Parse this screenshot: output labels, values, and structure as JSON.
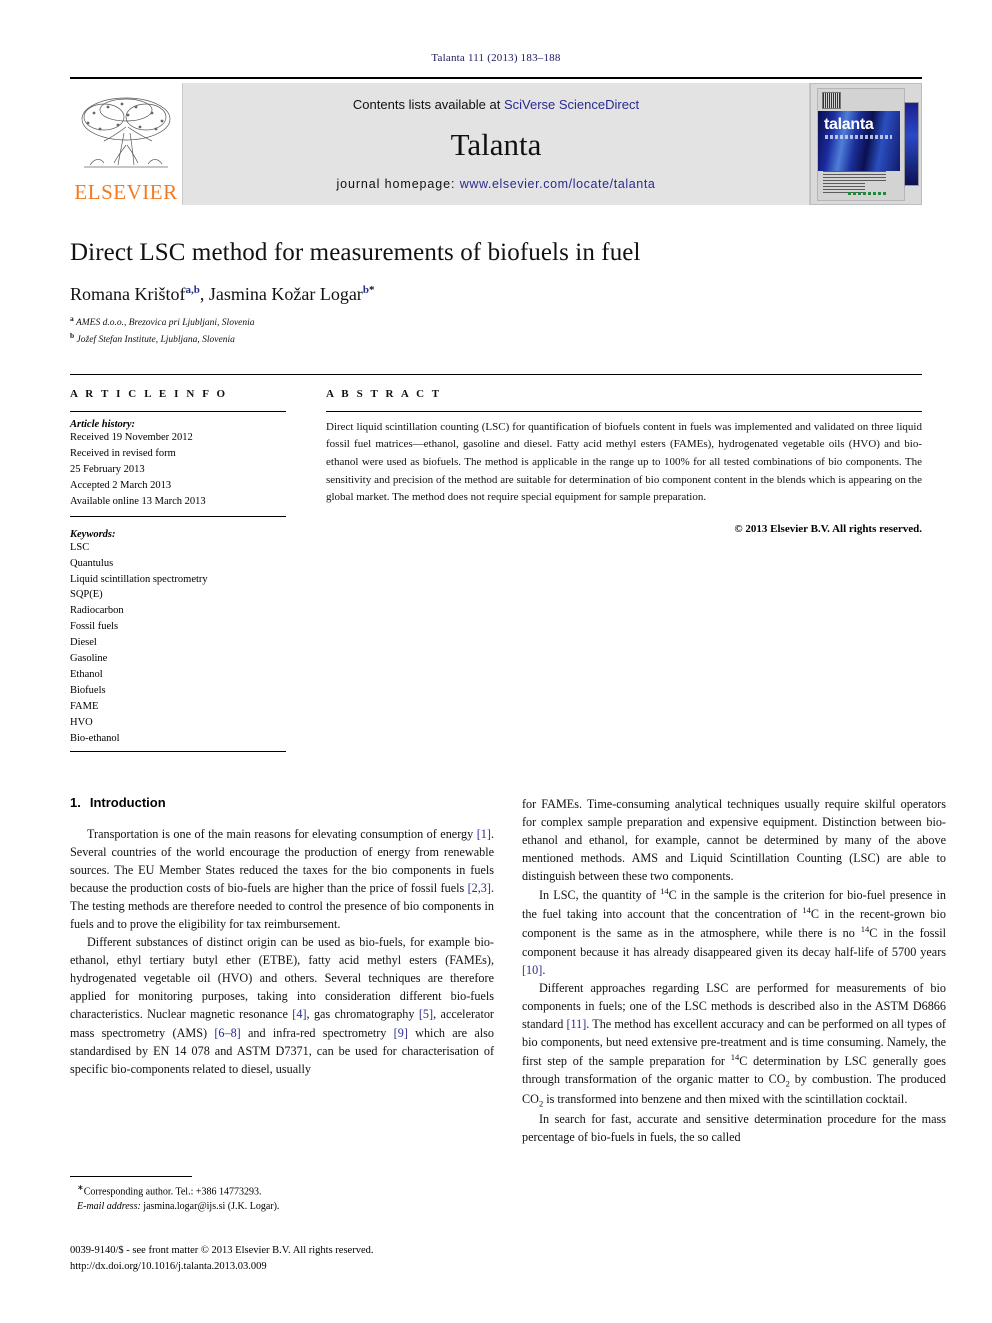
{
  "running_head": "Talanta 111 (2013) 183–188",
  "banner": {
    "publisher_logo_text": "ELSEVIER",
    "contents_prefix": "Contents lists available at ",
    "contents_link": "SciVerse ScienceDirect",
    "journal_name": "Talanta",
    "homepage_prefix": "journal homepage: ",
    "homepage_link": "www.elsevier.com/locate/talanta",
    "cover_title": "talanta"
  },
  "article": {
    "title": "Direct LSC method for measurements of biofuels in fuel",
    "authors_plain": "Romana Krištof",
    "author_1": "Romana Krištof",
    "author_1_sup": "a,b",
    "author_2": "Jasmina Kožar Logar",
    "author_2_sup": "b",
    "author_2_star": "*",
    "separator": ", ",
    "affiliation_a_sup": "a",
    "affiliation_a": "AMES d.o.o., Brezovica pri Ljubljani, Slovenia",
    "affiliation_b_sup": "b",
    "affiliation_b": "Jožef Stefan Institute, Ljubljana, Slovenia"
  },
  "info": {
    "heading": "A R T I C L E  I N F O",
    "history_label": "Article history:",
    "history": [
      "Received 19 November 2012",
      "Received in revised form",
      "25 February 2013",
      "Accepted 2 March 2013",
      "Available online 13 March 2013"
    ],
    "keywords_label": "Keywords:",
    "keywords": [
      "LSC",
      "Quantulus",
      "Liquid scintillation spectrometry",
      "SQP(E)",
      "Radiocarbon",
      "Fossil fuels",
      "Diesel",
      "Gasoline",
      "Ethanol",
      "Biofuels",
      "FAME",
      "HVO",
      "Bio-ethanol"
    ]
  },
  "abstract": {
    "heading": "A B S T R A C T",
    "text": "Direct liquid scintillation counting (LSC) for quantification of biofuels content in fuels was implemented and validated on three liquid fossil fuel matrices—ethanol, gasoline and diesel. Fatty acid methyl esters (FAMEs), hydrogenated vegetable oils (HVO) and bio-ethanol were used as biofuels. The method is applicable in the range up to 100% for all tested combinations of bio components. The sensitivity and precision of the method are suitable for determination of bio component content in the blends which is appearing on the global market. The method does not require special equipment for sample preparation.",
    "copyright": "© 2013 Elsevier B.V. All rights reserved."
  },
  "body": {
    "section_number": "1.",
    "section_title": "Introduction",
    "left_paragraphs": [
      {
        "parts": [
          {
            "t": "Transportation is one of the main reasons for elevating consumption of energy "
          },
          {
            "t": "[1]",
            "cite": true
          },
          {
            "t": ". Several countries of the world encourage the production of energy from renewable sources. The EU Member States reduced the taxes for the bio components in fuels because the production costs of bio-fuels are higher than the price of fossil fuels "
          },
          {
            "t": "[2,3]",
            "cite": true
          },
          {
            "t": ". The testing methods are therefore needed to control the presence of bio components in fuels and to prove the eligibility for tax reimbursement."
          }
        ]
      },
      {
        "parts": [
          {
            "t": "Different substances of distinct origin can be used as bio-fuels, for example bio-ethanol, ethyl tertiary butyl ether (ETBE), fatty acid methyl esters (FAMEs), hydrogenated vegetable oil (HVO) and others. Several techniques are therefore applied for monitoring purposes, taking into consideration different bio-fuels characteristics. Nuclear magnetic resonance "
          },
          {
            "t": "[4]",
            "cite": true
          },
          {
            "t": ", gas chromatography "
          },
          {
            "t": "[5]",
            "cite": true
          },
          {
            "t": ", accelerator mass spectrometry (AMS) "
          },
          {
            "t": "[6–8]",
            "cite": true
          },
          {
            "t": " and infra-red spectrometry "
          },
          {
            "t": "[9]",
            "cite": true
          },
          {
            "t": " which are also standardised by EN 14 078 and ASTM D7371, can be used for characterisation of specific bio-components related to diesel, usually"
          }
        ]
      }
    ],
    "right_paragraphs": [
      {
        "no_indent": true,
        "parts": [
          {
            "t": "for FAMEs. Time-consuming analytical techniques usually require skilful operators for complex sample preparation and expensive equipment. Distinction between bio-ethanol and ethanol, for example, cannot be determined by many of the above mentioned methods. AMS and Liquid Scintillation Counting (LSC) are able to distinguish between these two components."
          }
        ]
      },
      {
        "parts": [
          {
            "t": "In LSC, the quantity of "
          },
          {
            "t": "14",
            "sup": true
          },
          {
            "t": "C in the sample is the criterion for bio-fuel presence in the fuel taking into account that the concentration of "
          },
          {
            "t": "14",
            "sup": true
          },
          {
            "t": "C in the recent-grown bio component is the same as in the atmosphere, while there is no "
          },
          {
            "t": "14",
            "sup": true
          },
          {
            "t": "C in the fossil component because it has already disappeared given its decay half-life of 5700 years "
          },
          {
            "t": "[10]",
            "cite": true
          },
          {
            "t": "."
          }
        ]
      },
      {
        "parts": [
          {
            "t": "Different approaches regarding LSC are performed for measurements of bio components in fuels; one of the LSC methods is described also in the ASTM D6866 standard "
          },
          {
            "t": "[11]",
            "cite": true
          },
          {
            "t": ". The method has excellent accuracy and can be performed on all types of bio components, but need extensive pre-treatment and is time consuming. Namely, the first step of the sample preparation for "
          },
          {
            "t": "14",
            "sup": true
          },
          {
            "t": "C determination by LSC generally goes through transformation of the organic matter to CO"
          },
          {
            "t": "2",
            "sub": true
          },
          {
            "t": " by combustion. The produced CO"
          },
          {
            "t": "2",
            "sub": true
          },
          {
            "t": " is transformed into benzene and then mixed with the scintillation cocktail."
          }
        ]
      },
      {
        "parts": [
          {
            "t": "In search for fast, accurate and sensitive determination procedure for the mass percentage of bio-fuels in fuels, the so called"
          }
        ]
      }
    ]
  },
  "footnotes": {
    "corresponding": "Corresponding author. Tel.: +386 14773293.",
    "email_label": "E-mail address:",
    "email_value": "jasmina.logar@ijs.si (J.K. Logar)."
  },
  "imprint": {
    "line1": "0039-9140/$ - see front matter © 2013 Elsevier B.V. All rights reserved.",
    "line2": "http://dx.doi.org/10.1016/j.talanta.2013.03.009"
  }
}
